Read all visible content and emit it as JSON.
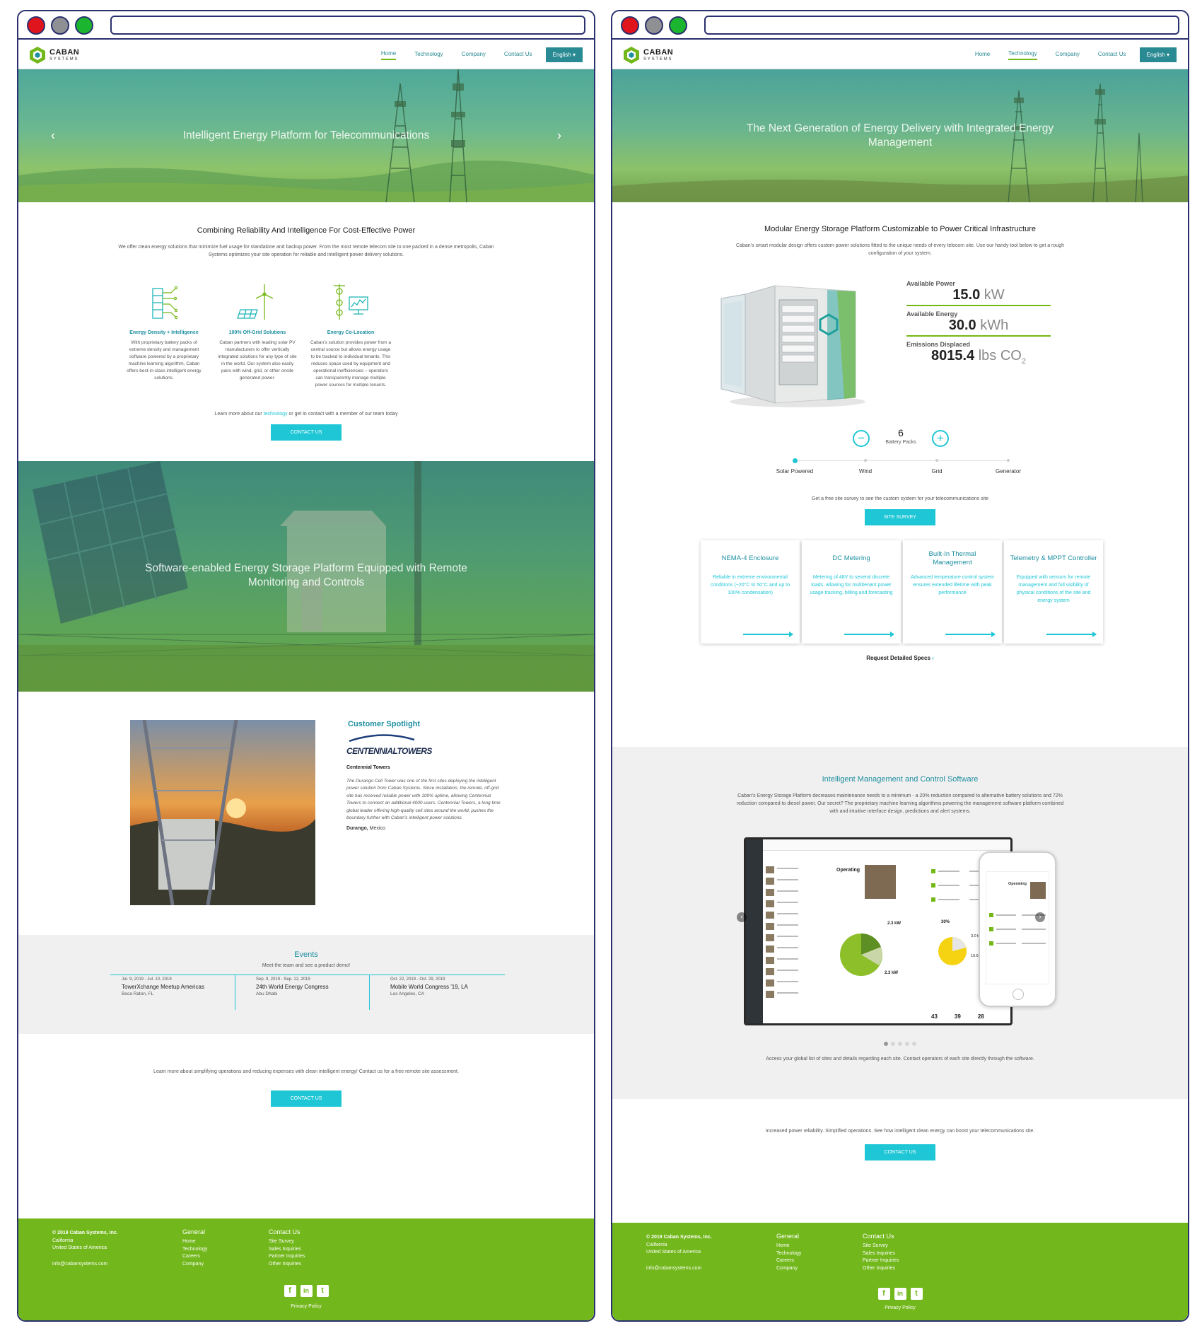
{
  "left": {
    "nav": {
      "logo_name": "CABAN",
      "logo_sub": "SYSTEMS",
      "items": [
        "Home",
        "Technology",
        "Company",
        "Contact Us"
      ],
      "active": "Home",
      "lang": "English"
    },
    "hero": {
      "title": "Intelligent Energy Platform for Telecommunications",
      "prev": "‹",
      "next": "›"
    },
    "intro": {
      "title": "Combining Reliability And Intelligence For Cost-Effective Power",
      "text": "We offer clean energy solutions that minimize fuel usage for standalone and backup power. From the most remote telecom site to one packed in a dense metropolis, Caban Systems optimizes your site operation for reliable and intelligent power delivery solutions."
    },
    "features": [
      {
        "icon": "battery-circuit-icon",
        "title": "Energy Density + Intelligence",
        "text": "With proprietary battery packs of extreme density and management software powered by a proprietary machine learning algorithm, Caban offers best-in-class intelligent energy solutions."
      },
      {
        "icon": "solar-wind-icon",
        "title": "100% Off-Grid Solutions",
        "text": "Caban partners with leading solar PV manufacturers to offer vertically integrated solutions for any type of site in the world. Our system also easily pairs with wind, grid, or other onsite generated power."
      },
      {
        "icon": "colocation-monitor-icon",
        "title": "Energy Co-Location",
        "text": "Caban’s solution provides power from a central source but allows energy usage to be tracked to individual tenants. This reduces space used by equipment and operational inefficiencies – operators can transparently manage multiple power sources for multiple tenants."
      }
    ],
    "learn": {
      "before": "Learn more about our ",
      "link": "technology",
      "after": " or get in contact with a member of our team today"
    },
    "contact_btn": "CONTACT US",
    "hero2": {
      "title": "Software-enabled Energy Storage Platform Equipped with Remote Monitoring and Controls"
    },
    "spotlight": {
      "title": "Customer Spotlight",
      "logo": "CENTENNIALTOWERS",
      "sub": "Centennial Towers",
      "text": "The Durango Cell Tower was one of the first sites deploying the intelligent power solution from Caban Systems. Since installation, the remote, off-grid site has received reliable power with 100% uptime, allowing Centennial Towers to connect an additional 4000 users. Centennial Towers, a long time global leader offering high-quality cell sites around the world, pushes the boundary further with Caban's intelligent power solutions.",
      "loc_city": "Durango,",
      "loc_country": " Mexico"
    },
    "events": {
      "title": "Events",
      "sub": "Meet the team and see a product demo!",
      "items": [
        {
          "date": "Jul. 9, 2019 - Jul. 10, 2019",
          "name": "TowerXchange Meetup Americas",
          "place": "Boca Raton, FL"
        },
        {
          "date": "Sep. 9, 2019 - Sep. 12, 2019",
          "name": "24th World Energy Congress",
          "place": "Abu Dhabi"
        },
        {
          "date": "Oct. 22, 2019 - Oct. 29, 2019",
          "name": "Mobile World Congress '19, LA",
          "place": "Los Angeles, CA"
        }
      ]
    },
    "cta": {
      "text": "Learn more about simplifying operations and reducing expenses with clean intelligent energy! Contact us for a free remote site assessment.",
      "btn": "CONTACT US"
    }
  },
  "right": {
    "nav": {
      "logo_name": "CABAN",
      "logo_sub": "SYSTEMS",
      "items": [
        "Home",
        "Technology",
        "Company",
        "Contact Us"
      ],
      "active": "Technology",
      "lang": "English"
    },
    "hero": {
      "title": "The Next Generation of Energy Delivery with Integrated Energy Management"
    },
    "modular": {
      "title": "Modular Energy Storage Platform Customizable to Power Critical Infrastructure",
      "text": "Caban’s smart modular design offers custom power solutions fitted to the unique needs of every telecom site. Use our handy tool below to get a rough configuration of your system."
    },
    "stats": {
      "power_label": "Available Power",
      "power_val": "15.0",
      "power_unit": " kW",
      "energy_label": "Available Energy",
      "energy_val": "30.0",
      "energy_unit": " kWh",
      "emis_label": "Emissions Displaced",
      "emis_val": "8015.4",
      "emis_unit": " lbs CO",
      "emis_sub": "2"
    },
    "config": {
      "count": "6",
      "label": "Battery Packs",
      "minus": "−",
      "plus": "+",
      "sources": [
        "Solar Powered",
        "Wind",
        "Grid",
        "Generator"
      ],
      "selected_index": 0
    },
    "survey": {
      "text": "Get a free site survey to see the custom system for your telecommunications site",
      "btn": "SITE SURVEY"
    },
    "cards": [
      {
        "title": "NEMA-4 Enclosure",
        "text": "Reliable in extreme environmental conditions (−20°C to 50°C and up to 100% condensation)"
      },
      {
        "title": "DC Metering",
        "text": "Metering of 48V to several discrete loads, allowing for multitenant power usage tracking, billing and forecasting"
      },
      {
        "title": "Built-In Thermal Management",
        "text": "Advanced temperature control system ensures extended lifetime with peak performance"
      },
      {
        "title": "Telemetry & MPPT Controller",
        "text": "Equipped with sensors for remote management and full visibility of physical conditions of the site and energy system"
      }
    ],
    "specs_link": "Request Detailed Specs",
    "software": {
      "title": "Intelligent Management and Control Software",
      "text": "Caban’s Energy Storage Platform decreases maintenance needs to a minimum - a 20% reduction compared to alternative battery solutions and 72% reduction compared to diesel power. Our secret? The proprietary machine learning algorithms powering the management software platform combined with and intuitive interface design, predictions and alert systems.",
      "caption": "Access your global list of sites and details regarding each site. Contact operators of each site directly through the software.",
      "dash_status": "Operating",
      "dash_kw1": "2.3",
      "dash_kw2": "2.3",
      "dash_pct": "30%",
      "dash_kw3": "3.0",
      "dash_kw4": "10.6",
      "dash_n1": "43",
      "dash_n2": "39",
      "dash_n3": "28",
      "carousel_count": 5,
      "carousel_active": 0
    },
    "cta": {
      "text": "Increased power reliability. Simplified operations. See how intelligent clean energy can boost your telecommunications site.",
      "btn": "CONTACT US"
    }
  },
  "footer": {
    "copyright": "© 2019 Caban Systems, Inc.",
    "state": "California",
    "country": "United States of America",
    "email": "info@cabansystems.com",
    "general_title": "General",
    "general": [
      "Home",
      "Technology",
      "Careers",
      "Company"
    ],
    "contact_title": "Contact Us",
    "contact": [
      "Site Survey",
      "Sales Inquiries",
      "Partner Inquiries",
      "Other Inquiries"
    ],
    "social": [
      {
        "icon": "facebook-icon",
        "glyph": "f"
      },
      {
        "icon": "linkedin-icon",
        "glyph": "in"
      },
      {
        "icon": "twitter-icon",
        "glyph": "t"
      }
    ],
    "privacy": "Privacy Policy"
  },
  "colors": {
    "teal": "#1d8fa0",
    "cyan": "#1fc6d6",
    "green": "#72b71b",
    "frame": "#2a2f6e"
  }
}
